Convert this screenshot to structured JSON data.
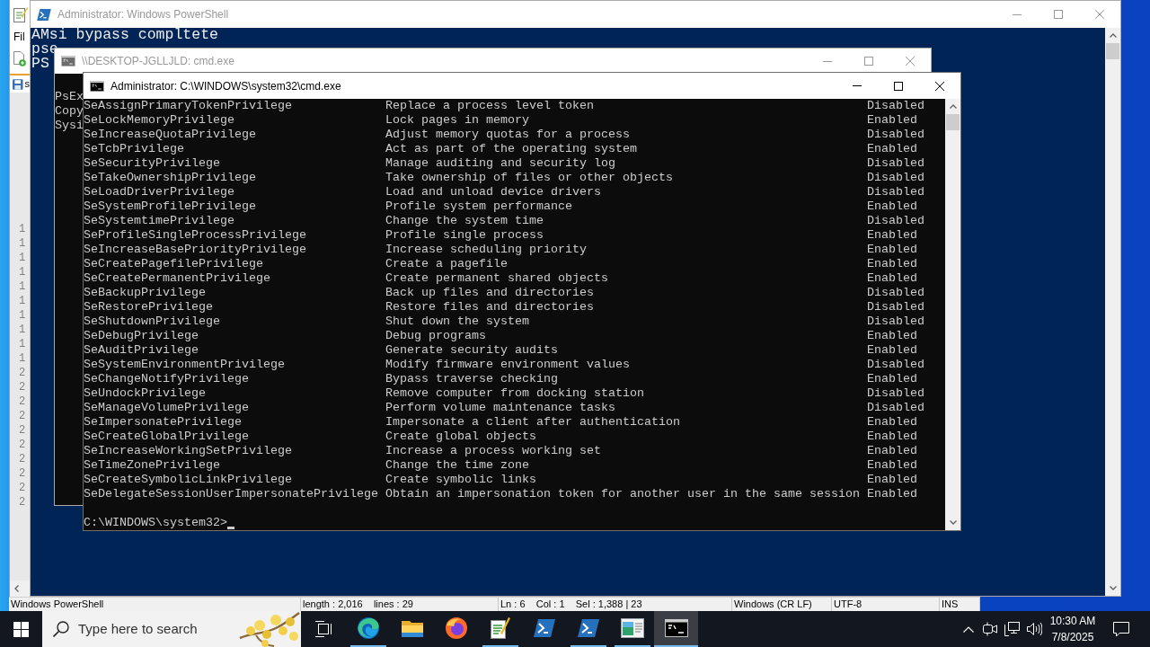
{
  "notepad_window": {
    "menu": [
      "Fil"
    ],
    "tabs": [
      {
        "label": "s",
        "selected": true
      }
    ],
    "line_numbers": [
      "1",
      "1",
      "1",
      "1",
      "1",
      "1",
      "1",
      "1",
      "1",
      "1",
      "2",
      "2",
      "2",
      "2",
      "2",
      "2",
      "2",
      "2",
      "2",
      "2"
    ],
    "status_bar": [
      "Windows PowerShell",
      "length : 2,016    lines : 29",
      "Ln : 6    Col : 1    Sel : 1,388 | 23",
      "Windows (CR LF)",
      "UTF-8",
      "INS"
    ]
  },
  "powershell_window": {
    "title": "Administrator: Windows PowerShell",
    "active": false,
    "lines": [
      "AMsi bypass compltete",
      "pse",
      "PS"
    ]
  },
  "remote_cmd_window": {
    "title": "\\\\DESKTOP-JGLLJLD: cmd.exe",
    "active": false,
    "lines": [
      "PsEx",
      "Copy",
      "Sysi"
    ]
  },
  "cmd_window": {
    "title": "Administrator: C:\\WINDOWS\\system32\\cmd.exe",
    "active": true,
    "privileges": [
      {
        "name": "SeAssignPrimaryTokenPrivilege",
        "description": "Replace a process level token",
        "state": "Disabled"
      },
      {
        "name": "SeLockMemoryPrivilege",
        "description": "Lock pages in memory",
        "state": "Enabled"
      },
      {
        "name": "SeIncreaseQuotaPrivilege",
        "description": "Adjust memory quotas for a process",
        "state": "Disabled"
      },
      {
        "name": "SeTcbPrivilege",
        "description": "Act as part of the operating system",
        "state": "Enabled"
      },
      {
        "name": "SeSecurityPrivilege",
        "description": "Manage auditing and security log",
        "state": "Disabled"
      },
      {
        "name": "SeTakeOwnershipPrivilege",
        "description": "Take ownership of files or other objects",
        "state": "Disabled"
      },
      {
        "name": "SeLoadDriverPrivilege",
        "description": "Load and unload device drivers",
        "state": "Disabled"
      },
      {
        "name": "SeSystemProfilePrivilege",
        "description": "Profile system performance",
        "state": "Enabled"
      },
      {
        "name": "SeSystemtimePrivilege",
        "description": "Change the system time",
        "state": "Disabled"
      },
      {
        "name": "SeProfileSingleProcessPrivilege",
        "description": "Profile single process",
        "state": "Enabled"
      },
      {
        "name": "SeIncreaseBasePriorityPrivilege",
        "description": "Increase scheduling priority",
        "state": "Enabled"
      },
      {
        "name": "SeCreatePagefilePrivilege",
        "description": "Create a pagefile",
        "state": "Enabled"
      },
      {
        "name": "SeCreatePermanentPrivilege",
        "description": "Create permanent shared objects",
        "state": "Enabled"
      },
      {
        "name": "SeBackupPrivilege",
        "description": "Back up files and directories",
        "state": "Disabled"
      },
      {
        "name": "SeRestorePrivilege",
        "description": "Restore files and directories",
        "state": "Disabled"
      },
      {
        "name": "SeShutdownPrivilege",
        "description": "Shut down the system",
        "state": "Disabled"
      },
      {
        "name": "SeDebugPrivilege",
        "description": "Debug programs",
        "state": "Enabled"
      },
      {
        "name": "SeAuditPrivilege",
        "description": "Generate security audits",
        "state": "Enabled"
      },
      {
        "name": "SeSystemEnvironmentPrivilege",
        "description": "Modify firmware environment values",
        "state": "Disabled"
      },
      {
        "name": "SeChangeNotifyPrivilege",
        "description": "Bypass traverse checking",
        "state": "Enabled"
      },
      {
        "name": "SeUndockPrivilege",
        "description": "Remove computer from docking station",
        "state": "Disabled"
      },
      {
        "name": "SeManageVolumePrivilege",
        "description": "Perform volume maintenance tasks",
        "state": "Disabled"
      },
      {
        "name": "SeImpersonatePrivilege",
        "description": "Impersonate a client after authentication",
        "state": "Enabled"
      },
      {
        "name": "SeCreateGlobalPrivilege",
        "description": "Create global objects",
        "state": "Enabled"
      },
      {
        "name": "SeIncreaseWorkingSetPrivilege",
        "description": "Increase a process working set",
        "state": "Enabled"
      },
      {
        "name": "SeTimeZonePrivilege",
        "description": "Change the time zone",
        "state": "Enabled"
      },
      {
        "name": "SeCreateSymbolicLinkPrivilege",
        "description": "Create symbolic links",
        "state": "Enabled"
      },
      {
        "name": "SeDelegateSessionUserImpersonatePrivilege",
        "description": "Obtain an impersonation token for another user in the same session",
        "state": "Enabled"
      }
    ],
    "prompt": "C:\\WINDOWS\\system32>"
  },
  "taskbar": {
    "search": {
      "label": "Type here to search"
    },
    "apps": [
      {
        "kind": "swirl",
        "running": true,
        "selected": false
      },
      {
        "kind": "folder",
        "running": false,
        "selected": false
      },
      {
        "kind": "fox",
        "running": false,
        "selected": false
      },
      {
        "kind": "notepad",
        "running": true,
        "selected": false
      },
      {
        "kind": "shell",
        "running": false,
        "selected": false
      },
      {
        "kind": "shell",
        "running": true,
        "selected": false
      },
      {
        "kind": "panel",
        "running": true,
        "selected": false
      },
      {
        "kind": "terminal",
        "running": true,
        "selected": true
      }
    ],
    "clock": {
      "time": "10:30 AM",
      "date": "7/8/2025"
    }
  }
}
